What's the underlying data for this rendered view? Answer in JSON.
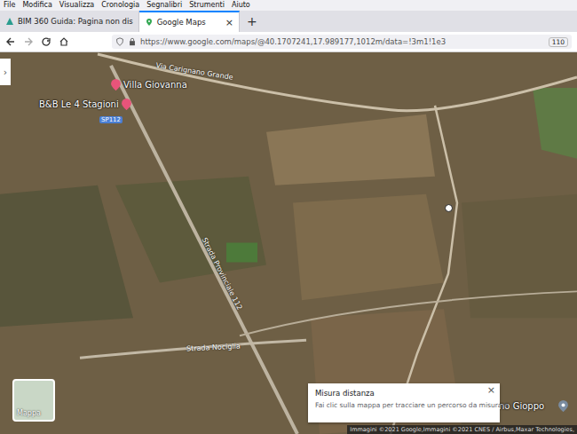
{
  "menu_bar": [
    "File",
    "Modifica",
    "Visualizza",
    "Cronologia",
    "Segnalibri",
    "Strumenti",
    "Aiuto"
  ],
  "tabs": [
    {
      "label": "BIM 360 Guida: Pagina non dis",
      "selected": false,
      "close": ""
    },
    {
      "label": "Google Maps",
      "selected": true,
      "close": "×"
    }
  ],
  "new_tab": "+",
  "address_bar": {
    "url": "https://www.google.com/maps/@40.1707241,17.989177,1012m/data=!3m1!1e3",
    "zoom": "110"
  },
  "map": {
    "places": [
      {
        "name": "B&B Le 4 Stagioni",
        "side": "left"
      },
      {
        "name": "Villa Giovanna",
        "side": "right"
      }
    ],
    "route_badge": "SP112",
    "roads": [
      {
        "name": "Via Carignano Grande",
        "kind": "top"
      },
      {
        "name": "Strada Provinciale 112",
        "kind": "diagonal"
      },
      {
        "name": "Strada Nociglia",
        "kind": "bottom"
      }
    ],
    "partial_place": "no Gioppo",
    "side_toggle": "›",
    "layer_toggle": "Mappa",
    "attribution": "Immagini ©2021 Google,Immagini ©2021 CNES / Airbus,Maxar Technologies,"
  },
  "measure_card": {
    "title": "Misura distanza",
    "hint": "Fai clic sulla mappa per tracciare un percorso da misurare",
    "close": "×"
  }
}
